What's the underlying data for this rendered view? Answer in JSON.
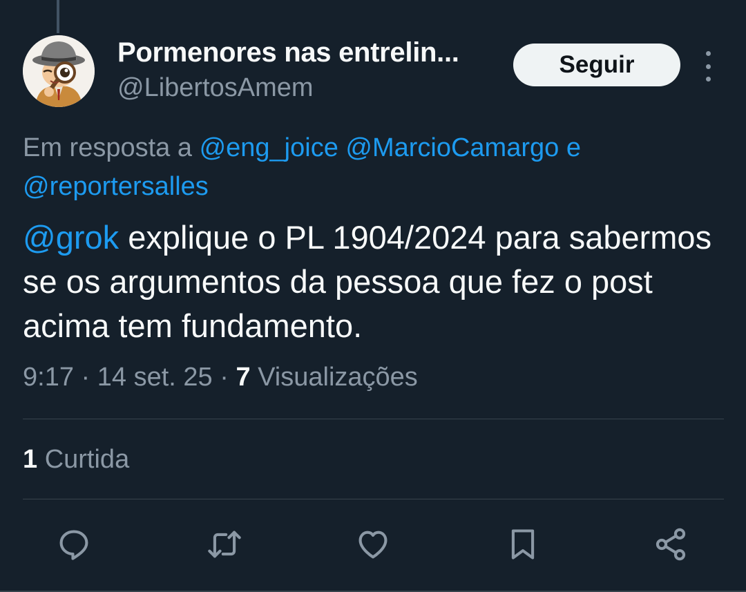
{
  "author": {
    "display_name": "Pormenores nas entrelin...",
    "handle": "@LibertosAmem",
    "avatar_icon": "detective-cartoon-avatar"
  },
  "follow_button": "Seguir",
  "more_icon": "more-vertical-icon",
  "reply_to": {
    "prefix": "Em resposta a",
    "mention_1": "@eng_joice",
    "mention_2": "@MarcioCamargo",
    "conjunction": "e",
    "mention_3": "@reportersalles"
  },
  "tweet": {
    "mention": "@grok",
    "text": "explique o PL 1904/2024 para sabermos se os argumentos da pessoa que fez o post acima tem fundamento."
  },
  "meta": {
    "time": "9:17",
    "separator": "·",
    "date": "14 set. 25",
    "views_count": "7",
    "views_label": "Visualizações"
  },
  "likes": {
    "count": "1",
    "label": "Curtida"
  },
  "actions": [
    {
      "name": "reply",
      "icon": "reply-icon"
    },
    {
      "name": "retweet",
      "icon": "retweet-icon"
    },
    {
      "name": "like",
      "icon": "heart-icon"
    },
    {
      "name": "bookmark",
      "icon": "bookmark-icon"
    },
    {
      "name": "share",
      "icon": "share-icon"
    }
  ],
  "colors": {
    "background": "#15202b",
    "text_primary": "#f7f9f9",
    "text_secondary": "#8b98a5",
    "link": "#1d9bf0",
    "divider": "#38444d",
    "follow_button_bg": "#eff3f4"
  }
}
